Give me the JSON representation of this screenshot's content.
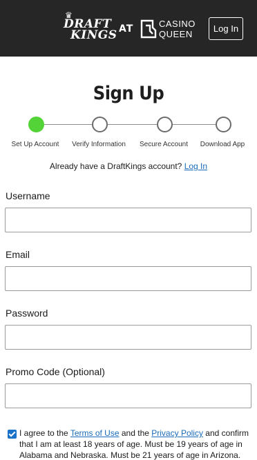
{
  "header": {
    "logo_line1": "DRAFT",
    "logo_line2": "KINGS",
    "logo_at": "AT",
    "partner_line1": "CASINO",
    "partner_line2": "QUEEN",
    "login_label": "Log In"
  },
  "title": "Sign Up",
  "stepper": {
    "steps": [
      {
        "label": "Set Up Account",
        "state": "active"
      },
      {
        "label": "Verify Information",
        "state": "pending"
      },
      {
        "label": "Secure Account",
        "state": "pending"
      },
      {
        "label": "Download App",
        "state": "pending"
      }
    ],
    "active_color": "#53d337"
  },
  "already": {
    "text": "Already have a DraftKings account?",
    "link": "Log In"
  },
  "form": {
    "username_label": "Username",
    "username_value": "",
    "email_label": "Email",
    "email_value": "",
    "password_label": "Password",
    "password_value": "",
    "promo_label": "Promo Code (Optional)",
    "promo_value": ""
  },
  "agreement": {
    "checked": true,
    "text1": "I agree to the",
    "terms_link": "Terms of Use",
    "text2": "and the",
    "privacy_link": "Privacy Policy",
    "text3": "and confirm that I am at least 18 years of age. Must be 19 years of age in Alabama and Nebraska. Must be 21 years of age in Arizona."
  },
  "colors": {
    "header_bg": "#262626",
    "link": "#1a6bb8",
    "checkbox": "#1a73c9"
  }
}
